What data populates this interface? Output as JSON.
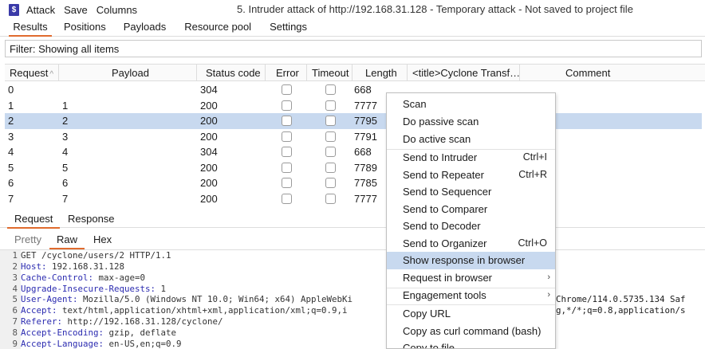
{
  "window": {
    "icon": "burp-app-icon",
    "icon_glyph": "$",
    "menu": [
      "Attack",
      "Save",
      "Columns"
    ],
    "title": "5. Intruder attack of http://192.168.31.128 - Temporary attack - Not saved to project file"
  },
  "tabs": [
    "Results",
    "Positions",
    "Payloads",
    "Resource pool",
    "Settings"
  ],
  "filter": "Filter: Showing all items",
  "table": {
    "columns": [
      "Request",
      "Payload",
      "Status code",
      "Error",
      "Timeout",
      "Length",
      "<title>Cyclone Transf…",
      "Comment"
    ],
    "sort_indicator": "^",
    "rows": [
      {
        "request": "0",
        "payload": "",
        "status": "304",
        "length": "668"
      },
      {
        "request": "1",
        "payload": "1",
        "status": "200",
        "length": "7777"
      },
      {
        "request": "2",
        "payload": "2",
        "status": "200",
        "length": "7795"
      },
      {
        "request": "3",
        "payload": "3",
        "status": "200",
        "length": "7791"
      },
      {
        "request": "4",
        "payload": "4",
        "status": "304",
        "length": "668"
      },
      {
        "request": "5",
        "payload": "5",
        "status": "200",
        "length": "7789"
      },
      {
        "request": "6",
        "payload": "6",
        "status": "200",
        "length": "7785"
      },
      {
        "request": "7",
        "payload": "7",
        "status": "200",
        "length": "7777"
      }
    ],
    "selected_row": "2"
  },
  "lower": {
    "tabs": [
      "Request",
      "Response"
    ],
    "sub_tabs": [
      "Pretty",
      "Raw",
      "Hex"
    ],
    "active_sub_tab": "Raw"
  },
  "request_lines": [
    {
      "n": "1",
      "key": "GET /cyclone/users/2 HTTP/1.1",
      "val": ""
    },
    {
      "n": "2",
      "key": "Host:",
      "val": " 192.168.31.128"
    },
    {
      "n": "3",
      "key": "Cache-Control:",
      "val": " max-age=0"
    },
    {
      "n": "4",
      "key": "Upgrade-Insecure-Requests:",
      "val": " 1"
    },
    {
      "n": "5",
      "key": "User-Agent:",
      "val": " Mozilla/5.0 (Windows NT 10.0; Win64; x64) AppleWebKi",
      "tail": "Chrome/114.0.5735.134 Saf"
    },
    {
      "n": "6",
      "key": "Accept:",
      "val": " text/html,application/xhtml+xml,application/xml;q=0.9,i",
      "tail": "g,*/*;q=0.8,application/s"
    },
    {
      "n": "7",
      "key": "Referer:",
      "val": " http://192.168.31.128/cyclone/"
    },
    {
      "n": "8",
      "key": "Accept-Encoding:",
      "val": " gzip, deflate"
    },
    {
      "n": "9",
      "key": "Accept-Language:",
      "val": " en-US,en;q=0.9"
    }
  ],
  "context_menu": {
    "items": [
      {
        "label": "Scan",
        "shortcut": "",
        "submenu": false
      },
      {
        "label": "Do passive scan",
        "shortcut": "",
        "submenu": false
      },
      {
        "label": "Do active scan",
        "shortcut": "",
        "submenu": false
      },
      {
        "label": "Send to Intruder",
        "shortcut": "Ctrl+I",
        "submenu": false
      },
      {
        "label": "Send to Repeater",
        "shortcut": "Ctrl+R",
        "submenu": false
      },
      {
        "label": "Send to Sequencer",
        "shortcut": "",
        "submenu": false
      },
      {
        "label": "Send to Comparer",
        "shortcut": "",
        "submenu": false
      },
      {
        "label": "Send to Decoder",
        "shortcut": "",
        "submenu": false
      },
      {
        "label": "Send to Organizer",
        "shortcut": "Ctrl+O",
        "submenu": false
      },
      {
        "label": "Show response in browser",
        "shortcut": "",
        "submenu": false
      },
      {
        "label": "Request in browser",
        "shortcut": "",
        "submenu": true
      },
      {
        "label": "Engagement tools",
        "shortcut": "",
        "submenu": true
      },
      {
        "label": "Copy URL",
        "shortcut": "",
        "submenu": false
      },
      {
        "label": "Copy as curl command (bash)",
        "shortcut": "",
        "submenu": false
      },
      {
        "label": "Copy to file",
        "shortcut": "",
        "submenu": false
      }
    ],
    "highlighted": "Show response in browser"
  },
  "colors": {
    "accent": "#e06b2e",
    "selection": "#c8d9ef",
    "header_key": "#2b2bb0"
  }
}
